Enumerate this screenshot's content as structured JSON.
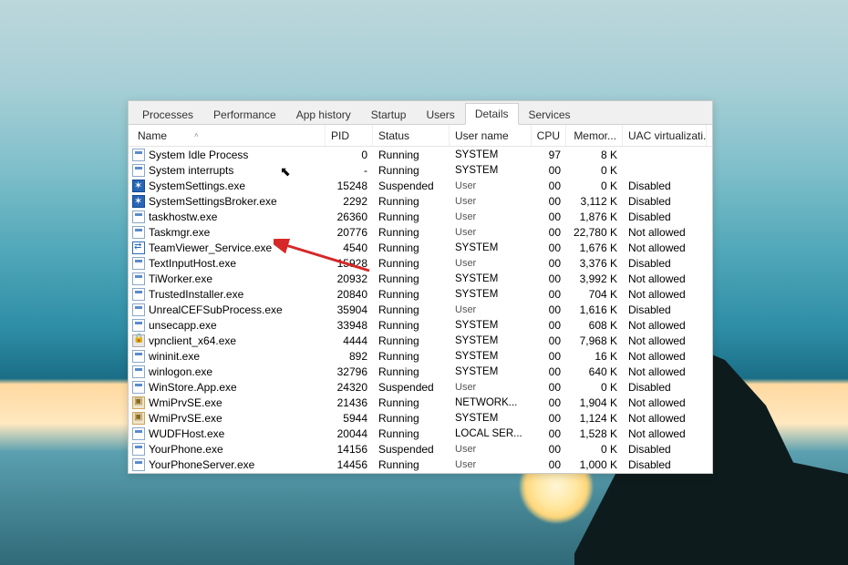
{
  "tabs": {
    "items": [
      "Processes",
      "Performance",
      "App history",
      "Startup",
      "Users",
      "Details",
      "Services"
    ],
    "active_index": 5
  },
  "columns": {
    "name": "Name",
    "pid": "PID",
    "status": "Status",
    "user": "User name",
    "cpu": "CPU",
    "mem": "Memor...",
    "uac": "UAC virtualizati..."
  },
  "rows": [
    {
      "icon": "app",
      "name": "System Idle Process",
      "pid": "0",
      "status": "Running",
      "user": "SYSTEM",
      "user_dim": false,
      "cpu": "97",
      "mem": "8 K",
      "uac": ""
    },
    {
      "icon": "app",
      "name": "System interrupts",
      "pid": "-",
      "status": "Running",
      "user": "SYSTEM",
      "user_dim": false,
      "cpu": "00",
      "mem": "0 K",
      "uac": ""
    },
    {
      "icon": "gear",
      "name": "SystemSettings.exe",
      "pid": "15248",
      "status": "Suspended",
      "user": "User",
      "user_dim": true,
      "cpu": "00",
      "mem": "0 K",
      "uac": "Disabled"
    },
    {
      "icon": "gear",
      "name": "SystemSettingsBroker.exe",
      "pid": "2292",
      "status": "Running",
      "user": "User",
      "user_dim": true,
      "cpu": "00",
      "mem": "3,112 K",
      "uac": "Disabled"
    },
    {
      "icon": "app",
      "name": "taskhostw.exe",
      "pid": "26360",
      "status": "Running",
      "user": "User",
      "user_dim": true,
      "cpu": "00",
      "mem": "1,876 K",
      "uac": "Disabled"
    },
    {
      "icon": "app",
      "name": "Taskmgr.exe",
      "pid": "20776",
      "status": "Running",
      "user": "User",
      "user_dim": true,
      "cpu": "00",
      "mem": "22,780 K",
      "uac": "Not allowed"
    },
    {
      "icon": "tv",
      "name": "TeamViewer_Service.exe",
      "pid": "4540",
      "status": "Running",
      "user": "SYSTEM",
      "user_dim": false,
      "cpu": "00",
      "mem": "1,676 K",
      "uac": "Not allowed"
    },
    {
      "icon": "app",
      "name": "TextInputHost.exe",
      "pid": "15928",
      "status": "Running",
      "user": "User",
      "user_dim": true,
      "cpu": "00",
      "mem": "3,376 K",
      "uac": "Disabled"
    },
    {
      "icon": "app",
      "name": "TiWorker.exe",
      "pid": "20932",
      "status": "Running",
      "user": "SYSTEM",
      "user_dim": false,
      "cpu": "00",
      "mem": "3,992 K",
      "uac": "Not allowed"
    },
    {
      "icon": "app",
      "name": "TrustedInstaller.exe",
      "pid": "20840",
      "status": "Running",
      "user": "SYSTEM",
      "user_dim": false,
      "cpu": "00",
      "mem": "704 K",
      "uac": "Not allowed"
    },
    {
      "icon": "app",
      "name": "UnrealCEFSubProcess.exe",
      "pid": "35904",
      "status": "Running",
      "user": "User",
      "user_dim": true,
      "cpu": "00",
      "mem": "1,616 K",
      "uac": "Disabled"
    },
    {
      "icon": "app",
      "name": "unsecapp.exe",
      "pid": "33948",
      "status": "Running",
      "user": "SYSTEM",
      "user_dim": false,
      "cpu": "00",
      "mem": "608 K",
      "uac": "Not allowed"
    },
    {
      "icon": "vpn",
      "name": "vpnclient_x64.exe",
      "pid": "4444",
      "status": "Running",
      "user": "SYSTEM",
      "user_dim": false,
      "cpu": "00",
      "mem": "7,968 K",
      "uac": "Not allowed"
    },
    {
      "icon": "app",
      "name": "wininit.exe",
      "pid": "892",
      "status": "Running",
      "user": "SYSTEM",
      "user_dim": false,
      "cpu": "00",
      "mem": "16 K",
      "uac": "Not allowed"
    },
    {
      "icon": "app",
      "name": "winlogon.exe",
      "pid": "32796",
      "status": "Running",
      "user": "SYSTEM",
      "user_dim": false,
      "cpu": "00",
      "mem": "640 K",
      "uac": "Not allowed"
    },
    {
      "icon": "app",
      "name": "WinStore.App.exe",
      "pid": "24320",
      "status": "Suspended",
      "user": "User",
      "user_dim": true,
      "cpu": "00",
      "mem": "0 K",
      "uac": "Disabled"
    },
    {
      "icon": "wmi",
      "name": "WmiPrvSE.exe",
      "pid": "21436",
      "status": "Running",
      "user": "NETWORK...",
      "user_dim": false,
      "cpu": "00",
      "mem": "1,904 K",
      "uac": "Not allowed"
    },
    {
      "icon": "wmi",
      "name": "WmiPrvSE.exe",
      "pid": "5944",
      "status": "Running",
      "user": "SYSTEM",
      "user_dim": false,
      "cpu": "00",
      "mem": "1,124 K",
      "uac": "Not allowed"
    },
    {
      "icon": "app",
      "name": "WUDFHost.exe",
      "pid": "20044",
      "status": "Running",
      "user": "LOCAL SER...",
      "user_dim": false,
      "cpu": "00",
      "mem": "1,528 K",
      "uac": "Not allowed"
    },
    {
      "icon": "app",
      "name": "YourPhone.exe",
      "pid": "14156",
      "status": "Suspended",
      "user": "User",
      "user_dim": true,
      "cpu": "00",
      "mem": "0 K",
      "uac": "Disabled"
    },
    {
      "icon": "app",
      "name": "YourPhoneServer.exe",
      "pid": "14456",
      "status": "Running",
      "user": "User",
      "user_dim": true,
      "cpu": "00",
      "mem": "1,000 K",
      "uac": "Disabled"
    }
  ],
  "annotation": {
    "arrow_color": "#d62828",
    "highlighted_row_index": 7
  }
}
